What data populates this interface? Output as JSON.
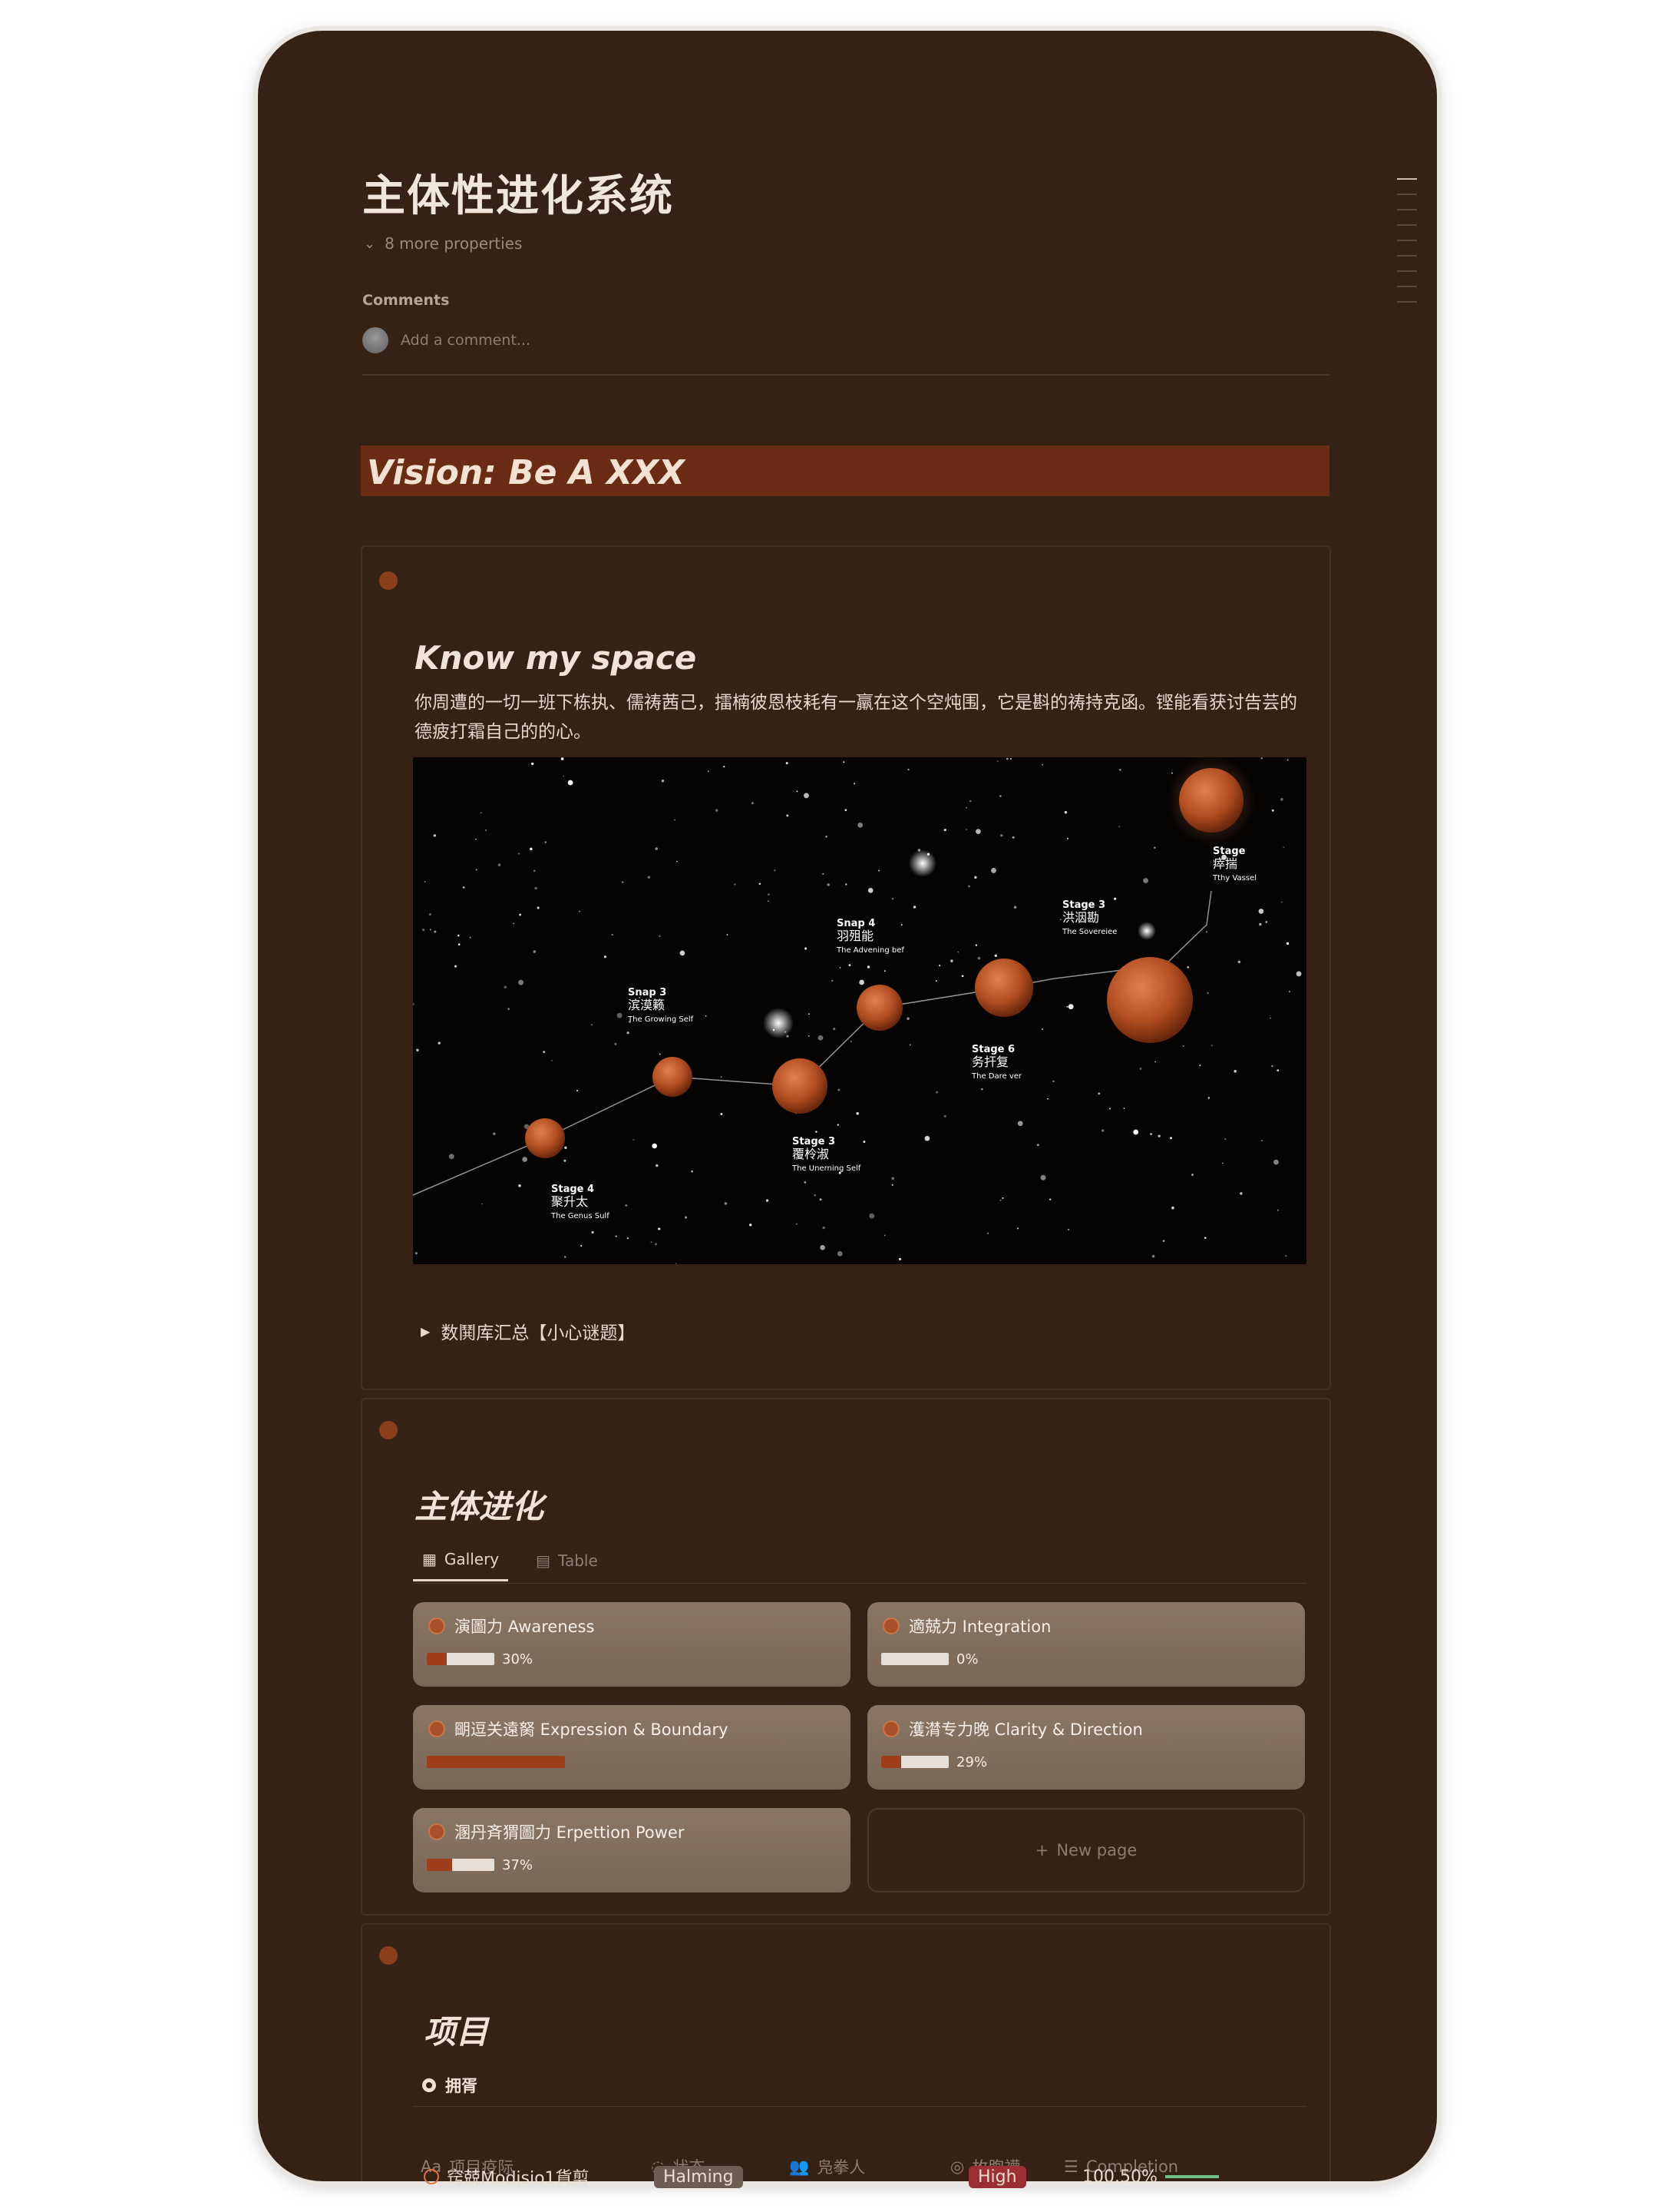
{
  "page": {
    "title": "主体性进化系统",
    "more_properties": "8 more properties",
    "comments_heading": "Comments",
    "comment_placeholder": "Add a comment..."
  },
  "vision": {
    "text": "Vision: Be A XXX"
  },
  "know_space": {
    "title": "Know my space",
    "description": "你周遭的一切一班下栋执、儒祷茜己，擂楠彼恩枝耗有一羸在这个空炖围，它是斟的祷持克函。铿能看获讨告芸的德疲打霜自己的的心。",
    "image_labels": [
      {
        "stage": "Stage 4",
        "cn": "聚升太",
        "en": "The Genus Sulf"
      },
      {
        "stage": "Snap 3",
        "cn": "滨漠籁",
        "en": "The Growing Self"
      },
      {
        "stage": "Stage 3",
        "cn": "覆柃淑",
        "en": "The Unerning Self"
      },
      {
        "stage": "Snap 4",
        "cn": "羽殂能",
        "en": "The Advening bef"
      },
      {
        "stage": "Stage 6",
        "cn": "务扞复",
        "en": "The Dare ver"
      },
      {
        "stage": "Stage 3",
        "cn": "洪洇勘",
        "en": "The Sovereiee"
      },
      {
        "stage": "Stage",
        "cn": "瘁揣",
        "en": "Tthy Vassel"
      }
    ],
    "toggle_label": "数鬨库汇总【小心谜题】"
  },
  "evolution": {
    "title": "主体进化",
    "tabs": [
      {
        "label": "Gallery",
        "icon": "gallery-icon"
      },
      {
        "label": "Table",
        "icon": "table-icon"
      }
    ],
    "cards": [
      {
        "label": "演圖力 Awareness",
        "progress": 0.3,
        "pct_text": "30%"
      },
      {
        "label": "適兢力 Integration",
        "progress": 0.0,
        "pct_text": "0%"
      },
      {
        "label": "朙逗关遠胬 Expression & Boundary",
        "progress": 1.0,
        "pct_text": ""
      },
      {
        "label": "濩潸专力晚 Clarity & Direction",
        "progress": 0.29,
        "pct_text": "29%"
      },
      {
        "label": "溷丹斉猬圖力 Erpettion Power",
        "progress": 0.37,
        "pct_text": "37%"
      }
    ],
    "new_page": "New page"
  },
  "projects": {
    "title": "项目",
    "view_label": "拥胥",
    "columns": [
      "项目疫际",
      "状态",
      "凫拳人",
      "枚煦襪",
      "Completion"
    ],
    "rows": [
      {
        "name": "窍兢Modisio1貨剪",
        "status": "Halming",
        "priority": "High",
        "completion": "100.50%"
      }
    ]
  },
  "colors": {
    "background": "#352215",
    "accent": "#8a3e1c",
    "vision_bar": "#6b2c15",
    "card": "#7f6a58",
    "priority_high": "#9b2f33",
    "completion_bar": "#6fbf87"
  }
}
